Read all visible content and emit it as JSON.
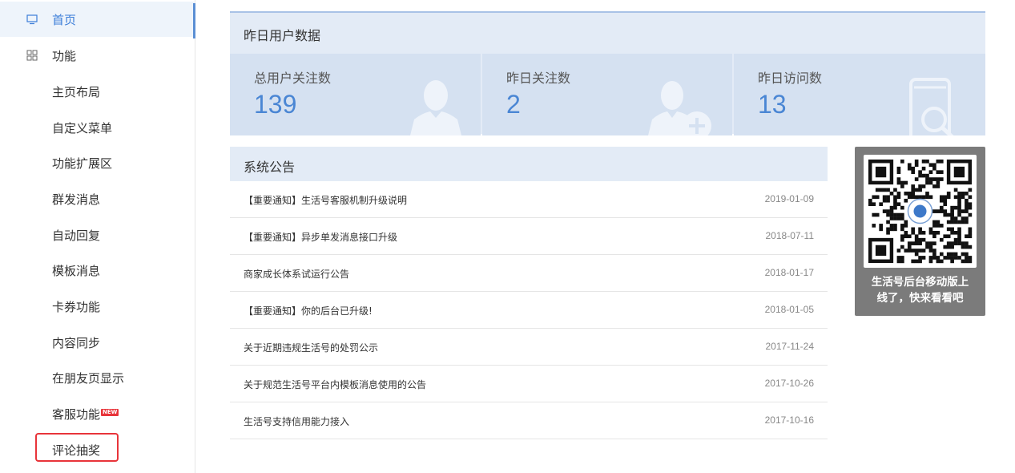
{
  "sidebar": {
    "home": {
      "label": "首页",
      "icon": "monitor-icon"
    },
    "features": {
      "label": "功能",
      "icon": "grid-icon"
    },
    "items": [
      {
        "label": "主页布局"
      },
      {
        "label": "自定义菜单"
      },
      {
        "label": "功能扩展区"
      },
      {
        "label": "群发消息"
      },
      {
        "label": "自动回复"
      },
      {
        "label": "模板消息"
      },
      {
        "label": "卡券功能"
      },
      {
        "label": "内容同步"
      },
      {
        "label": "在朋友页显示"
      },
      {
        "label": "客服功能",
        "badge": "NEW"
      },
      {
        "label": "评论抽奖"
      }
    ]
  },
  "stats": {
    "title": "昨日用户数据",
    "cards": [
      {
        "label": "总用户关注数",
        "value": "139",
        "icon": "user-icon"
      },
      {
        "label": "昨日关注数",
        "value": "2",
        "icon": "user-add-icon"
      },
      {
        "label": "昨日访问数",
        "value": "13",
        "icon": "phone-search-icon"
      }
    ]
  },
  "notice": {
    "title": "系统公告",
    "rows": [
      {
        "title": "【重要通知】生活号客服机制升级说明",
        "date": "2019-01-09"
      },
      {
        "title": "【重要通知】异步单发消息接口升级",
        "date": "2018-07-11"
      },
      {
        "title": "商家成长体系试运行公告",
        "date": "2018-01-17"
      },
      {
        "title": "【重要通知】你的后台已升级!",
        "date": "2018-01-05"
      },
      {
        "title": "关于近期违规生活号的处罚公示",
        "date": "2017-11-24"
      },
      {
        "title": "关于规范生活号平台内模板消息使用的公告",
        "date": "2017-10-26"
      },
      {
        "title": "生活号支持信用能力接入",
        "date": "2017-10-16"
      }
    ]
  },
  "qr": {
    "caption_line1": "生活号后台移动版上",
    "caption_line2": "线了，快来看看吧"
  },
  "colors": {
    "accent": "#4a86d4",
    "panel": "#e3ebf6",
    "card": "#d5e1f1",
    "highlight": "#e8343a"
  }
}
